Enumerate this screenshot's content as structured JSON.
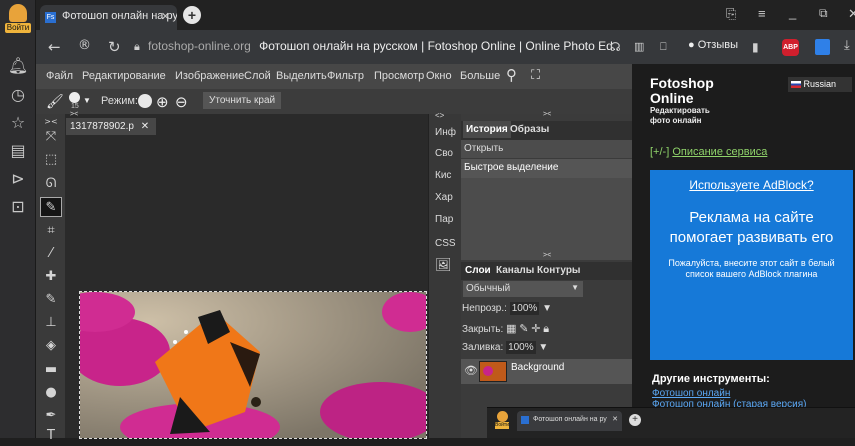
{
  "browser": {
    "login_label": "Войти",
    "tab_title": "Фотошоп онлайн на ру",
    "url_domain": "fotoshop-online.org",
    "page_title": "Фотошоп онлайн на русском | Fotoshop Online | Online Photo Ed...",
    "reviews_label": "Отзывы",
    "adblock_badge": "ABP"
  },
  "editor": {
    "menu": [
      "Файл",
      "Редактирование",
      "Изображение",
      "Слой",
      "Выделить",
      "Фильтр",
      "Просмотр",
      "Окно",
      "Больше"
    ],
    "mode_label": "Режим:",
    "brush_size": "15",
    "refine_edge": "Уточнить край",
    "doc_name": "1317878902.p",
    "side_tabs": [
      "Инф",
      "Сво",
      "Кис",
      "Хар",
      "Пар",
      "CSS"
    ],
    "history": {
      "tabs": [
        "История",
        "Образы"
      ],
      "items": [
        "Открыть",
        "Быстрое выделение"
      ]
    },
    "layers": {
      "tabs": [
        "Слои",
        "Каналы",
        "Контуры"
      ],
      "blend_mode": "Обычный",
      "opacity_label": "Непрозр.:",
      "opacity_value": "100%",
      "lock_label": "Закрыть:",
      "fill_label": "Заливка:",
      "fill_value": "100%",
      "layer_name": "Background"
    }
  },
  "site": {
    "logo_line1": "Fotoshop",
    "logo_line2": "Online",
    "logo_sub": "Редактировать фото онлайн",
    "language": "Russian",
    "desc_prefix": "[+/-]",
    "desc_link": "Описание сервиса",
    "ad": {
      "question": "Используете AdBlock?",
      "headline": "Реклама на сайте помогает развивать его",
      "body": "Пожалуйста, внесите этот сайт в белый список вашего AdBlock плагина"
    },
    "other_tools_title": "Другие инструменты:",
    "other_links": [
      "Фотошоп онлайн",
      "Фотошоп онлайн (старая версия)"
    ]
  },
  "colors": {
    "accent": "#1679d8",
    "link": "#8fd36a",
    "history_tab": "#4a4a4a"
  }
}
